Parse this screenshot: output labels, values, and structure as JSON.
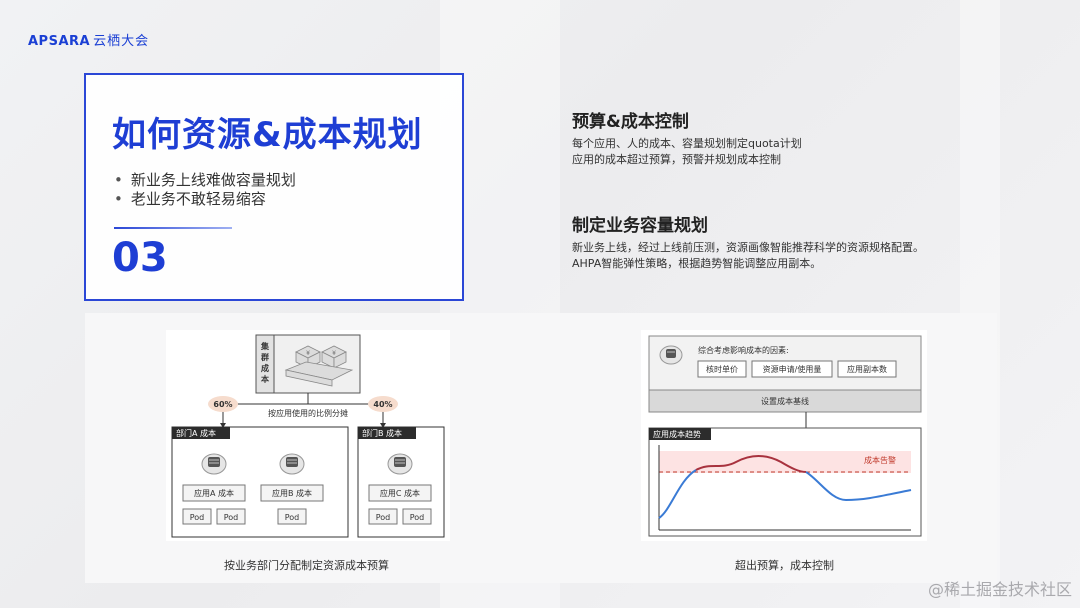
{
  "logo": {
    "brand": "APSARA",
    "cn": "云栖大会"
  },
  "title_card": {
    "title": "如何资源&成本规划",
    "bullets": [
      "新业务上线难做容量规划",
      "老业务不敢轻易缩容"
    ],
    "number": "03"
  },
  "sections": [
    {
      "heading": "预算&成本控制",
      "lines": [
        "每个应用、人的成本、容量规划制定quota计划",
        "应用的成本超过预算，预警并规划成本控制"
      ]
    },
    {
      "heading": "制定业务容量规划",
      "lines": [
        "新业务上线，经过上线前压测，资源画像智能推荐科学的资源规格配置。",
        "AHPA智能弹性策略，根据趋势智能调整应用副本。"
      ]
    }
  ],
  "diagram_left": {
    "cluster_label": "集\n群\n成\n本",
    "pct_a": "60%",
    "pct_b": "40%",
    "split_label": "按应用使用的比例分摊",
    "dept_a": "部门A 成本",
    "dept_b": "部门B 成本",
    "apps": [
      "应用A 成本",
      "应用B 成本",
      "应用C 成本"
    ],
    "pod": "Pod",
    "caption": "按业务部门分配制定资源成本预算"
  },
  "diagram_right": {
    "factors_label": "综合考虑影响成本的因素:",
    "factors": [
      "核时单价",
      "资源申请/使用量",
      "应用副本数"
    ],
    "baseline": "设置成本基线",
    "trend_label": "应用成本趋势",
    "alert": "成本告警",
    "caption": "超出预算，成本控制"
  },
  "watermark": "@稀土掘金技术社区",
  "colors": {
    "accent": "#1e3ed4",
    "alert_red": "#c0392b",
    "trend_blue": "#3a7bd5",
    "over_red": "#a8323e"
  }
}
